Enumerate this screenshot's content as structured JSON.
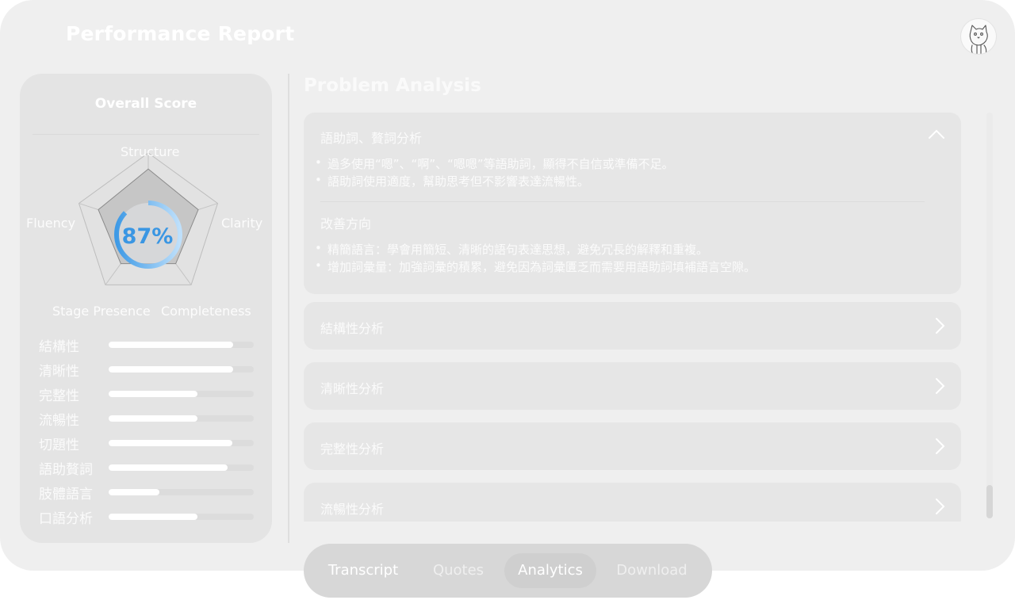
{
  "header": {
    "title": "Performance Report",
    "avatar_icon": "cat-avatar-icon"
  },
  "score_panel": {
    "title": "Overall Score",
    "score": "87%",
    "score_fraction": 0.87,
    "radar": {
      "axes": [
        "Structure",
        "Clarity",
        "Completeness",
        "Stage Presence",
        "Fluency"
      ],
      "values": [
        0.78,
        0.72,
        0.64,
        0.64,
        0.72
      ]
    },
    "metrics": [
      {
        "label": "結構性",
        "value": 0.86
      },
      {
        "label": "清晰性",
        "value": 0.86
      },
      {
        "label": "完整性",
        "value": 0.61
      },
      {
        "label": "流暢性",
        "value": 0.61
      },
      {
        "label": "切題性",
        "value": 0.85
      },
      {
        "label": "語助贅詞",
        "value": 0.82
      },
      {
        "label": "肢體語言",
        "value": 0.35
      },
      {
        "label": "口語分析",
        "value": 0.61
      }
    ]
  },
  "analysis": {
    "title": "Problem Analysis",
    "expanded": {
      "title": "語助詞、贅詞分析",
      "bullets": [
        "過多使用“嗯”、“啊”、“嗯嗯”等語助詞，顯得不自信或準備不足。",
        "語助詞使用適度，幫助思考但不影響表達流暢性。"
      ],
      "improve_title": "改善方向",
      "improve_bullets": [
        "精簡語言：學會用簡短、清晰的語句表達思想，避免冗長的解釋和重複。",
        "增加詞彙量：加強詞彙的積累，避免因為詞彙匱乏而需要用語助詞填補語言空隙。"
      ]
    },
    "collapsed": [
      {
        "title": "結構性分析"
      },
      {
        "title": "清晰性分析"
      },
      {
        "title": "完整性分析"
      },
      {
        "title": "流暢性分析"
      }
    ]
  },
  "tabs": [
    {
      "label": "Transcript"
    },
    {
      "label": "Quotes"
    },
    {
      "label": "Analytics"
    },
    {
      "label": "Download"
    }
  ],
  "active_tab": "Analytics",
  "colors": {
    "score_ring": "#5aa9ec",
    "score_text": "#3a96e3"
  }
}
